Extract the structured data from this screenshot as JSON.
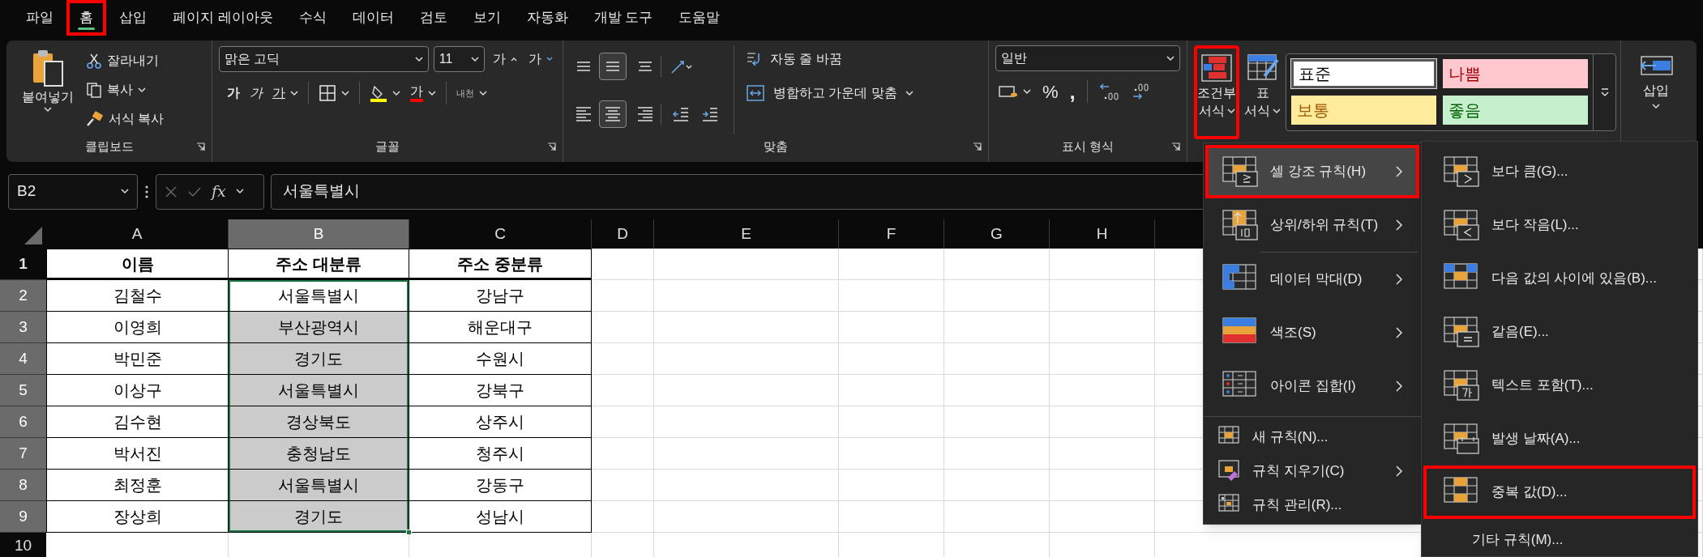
{
  "menu_tabs": [
    {
      "label": "파일",
      "selected": false,
      "highlighted": false
    },
    {
      "label": "홈",
      "selected": true,
      "highlighted": true
    },
    {
      "label": "삽입",
      "selected": false,
      "highlighted": false
    },
    {
      "label": "페이지 레이아웃",
      "selected": false,
      "highlighted": false
    },
    {
      "label": "수식",
      "selected": false,
      "highlighted": false
    },
    {
      "label": "데이터",
      "selected": false,
      "highlighted": false
    },
    {
      "label": "검토",
      "selected": false,
      "highlighted": false
    },
    {
      "label": "보기",
      "selected": false,
      "highlighted": false
    },
    {
      "label": "자동화",
      "selected": false,
      "highlighted": false
    },
    {
      "label": "개발 도구",
      "selected": false,
      "highlighted": false
    },
    {
      "label": "도움말",
      "selected": false,
      "highlighted": false
    }
  ],
  "ribbon": {
    "clipboard": {
      "paste": "붙여넣기",
      "cut": "잘라내기",
      "copy": "복사",
      "format_painter": "서식 복사",
      "label": "클립보드"
    },
    "font": {
      "font_name": "맑은 고딕",
      "font_size": "11",
      "grow": "가",
      "shrink": "가",
      "bold": "가",
      "italic": "가",
      "underline": "가",
      "font_color": "가",
      "phonetic": "내천",
      "label": "글꼴"
    },
    "alignment": {
      "wrap_text": "자동 줄 바꿈",
      "merge_center": "병합하고 가운데 맞춤",
      "label": "맞춤"
    },
    "number": {
      "format": "일반",
      "percent": "%",
      "comma": ",",
      "label": "표시 형식"
    },
    "styles": {
      "conditional_formatting": {
        "line1": "조건부",
        "line2": "서식",
        "highlighted": true
      },
      "format_as_table": {
        "line1": "표",
        "line2": "서식"
      },
      "cell_styles": [
        {
          "label": "표준",
          "color": "#ffffff",
          "selected": true
        },
        {
          "label": "나쁨",
          "color": "#ffc7ce",
          "selected": false
        },
        {
          "label": "보통",
          "color": "#ffeb9c",
          "selected": false
        },
        {
          "label": "좋음",
          "color": "#c6efce",
          "selected": false
        }
      ]
    },
    "cells": {
      "insert": "삽입"
    }
  },
  "formula_bar": {
    "name_box": "B2",
    "function_glyph": "fx",
    "formula": "서울특별시"
  },
  "sheet": {
    "columns": [
      {
        "label": "A",
        "selected": false
      },
      {
        "label": "B",
        "selected": true
      },
      {
        "label": "C",
        "selected": false
      },
      {
        "label": "D",
        "selected": false
      },
      {
        "label": "E",
        "selected": false
      },
      {
        "label": "F",
        "selected": false
      },
      {
        "label": "G",
        "selected": false
      },
      {
        "label": "H",
        "selected": false
      }
    ],
    "rows": [
      {
        "number": "1",
        "selected": false,
        "header": true,
        "cells": [
          {
            "text": "이름",
            "shaded": false,
            "selected": false
          },
          {
            "text": "주소 대분류",
            "shaded": false,
            "selected": false
          },
          {
            "text": "주소 중분류",
            "shaded": false,
            "selected": false
          }
        ]
      },
      {
        "number": "2",
        "selected": true,
        "header": false,
        "cells": [
          {
            "text": "김철수",
            "shaded": false,
            "selected": false
          },
          {
            "text": "서울특별시",
            "shaded": false,
            "selected": true
          },
          {
            "text": "강남구",
            "shaded": false,
            "selected": false
          }
        ]
      },
      {
        "number": "3",
        "selected": true,
        "header": false,
        "cells": [
          {
            "text": "이영희",
            "shaded": false,
            "selected": false
          },
          {
            "text": "부산광역시",
            "shaded": true,
            "selected": true
          },
          {
            "text": "해운대구",
            "shaded": false,
            "selected": false
          }
        ]
      },
      {
        "number": "4",
        "selected": true,
        "header": false,
        "cells": [
          {
            "text": "박민준",
            "shaded": false,
            "selected": false
          },
          {
            "text": "경기도",
            "shaded": true,
            "selected": true
          },
          {
            "text": "수원시",
            "shaded": false,
            "selected": false
          }
        ]
      },
      {
        "number": "5",
        "selected": true,
        "header": false,
        "cells": [
          {
            "text": "이상구",
            "shaded": false,
            "selected": false
          },
          {
            "text": "서울특별시",
            "shaded": true,
            "selected": true
          },
          {
            "text": "강북구",
            "shaded": false,
            "selected": false
          }
        ]
      },
      {
        "number": "6",
        "selected": true,
        "header": false,
        "cells": [
          {
            "text": "김수현",
            "shaded": false,
            "selected": false
          },
          {
            "text": "경상북도",
            "shaded": true,
            "selected": true
          },
          {
            "text": "상주시",
            "shaded": false,
            "selected": false
          }
        ]
      },
      {
        "number": "7",
        "selected": true,
        "header": false,
        "cells": [
          {
            "text": "박서진",
            "shaded": false,
            "selected": false
          },
          {
            "text": "충청남도",
            "shaded": true,
            "selected": true
          },
          {
            "text": "청주시",
            "shaded": false,
            "selected": false
          }
        ]
      },
      {
        "number": "8",
        "selected": true,
        "header": false,
        "cells": [
          {
            "text": "최정훈",
            "shaded": false,
            "selected": false
          },
          {
            "text": "서울특별시",
            "shaded": true,
            "selected": true
          },
          {
            "text": "강동구",
            "shaded": false,
            "selected": false
          }
        ]
      },
      {
        "number": "9",
        "selected": true,
        "header": false,
        "cells": [
          {
            "text": "장상희",
            "shaded": false,
            "selected": false
          },
          {
            "text": "경기도",
            "shaded": true,
            "selected": true
          },
          {
            "text": "성남시",
            "shaded": false,
            "selected": false
          }
        ]
      },
      {
        "number": "10",
        "selected": false,
        "header": false,
        "cells": []
      }
    ]
  },
  "conditional_menu": {
    "items": [
      {
        "label": "셀 강조 규칙(H)",
        "kind": "large",
        "submenu": true,
        "selected": true,
        "highlighted": true
      },
      {
        "label": "상위/하위 규칙(T)",
        "kind": "large",
        "submenu": true,
        "selected": false,
        "highlighted": false
      },
      {
        "label": "데이터 막대(D)",
        "kind": "large",
        "submenu": true,
        "selected": false,
        "highlighted": false
      },
      {
        "label": "색조(S)",
        "kind": "large",
        "submenu": true,
        "selected": false,
        "highlighted": false
      },
      {
        "label": "아이콘 집합(I)",
        "kind": "large",
        "submenu": true,
        "selected": false,
        "highlighted": false
      },
      {
        "label": "새 규칙(N)...",
        "kind": "small",
        "submenu": false,
        "selected": false,
        "highlighted": false
      },
      {
        "label": "규칙 지우기(C)",
        "kind": "small",
        "submenu": true,
        "selected": false,
        "highlighted": false
      },
      {
        "label": "규칙 관리(R)...",
        "kind": "small",
        "submenu": false,
        "selected": false,
        "highlighted": false
      }
    ]
  },
  "highlight_submenu": {
    "items": [
      {
        "label": "보다 큼(G)...",
        "kind": "large",
        "highlighted": false
      },
      {
        "label": "보다 작음(L)...",
        "kind": "large",
        "highlighted": false
      },
      {
        "label": "다음 값의 사이에 있음(B)...",
        "kind": "large",
        "highlighted": false
      },
      {
        "label": "같음(E)...",
        "kind": "large",
        "highlighted": false
      },
      {
        "label": "텍스트 포함(T)...",
        "kind": "large",
        "highlighted": false
      },
      {
        "label": "발생 날짜(A)...",
        "kind": "large",
        "highlighted": false
      },
      {
        "label": "중복 값(D)...",
        "kind": "large",
        "highlighted": true
      },
      {
        "label": "기타 규칙(M)...",
        "kind": "plain",
        "highlighted": false
      }
    ]
  }
}
